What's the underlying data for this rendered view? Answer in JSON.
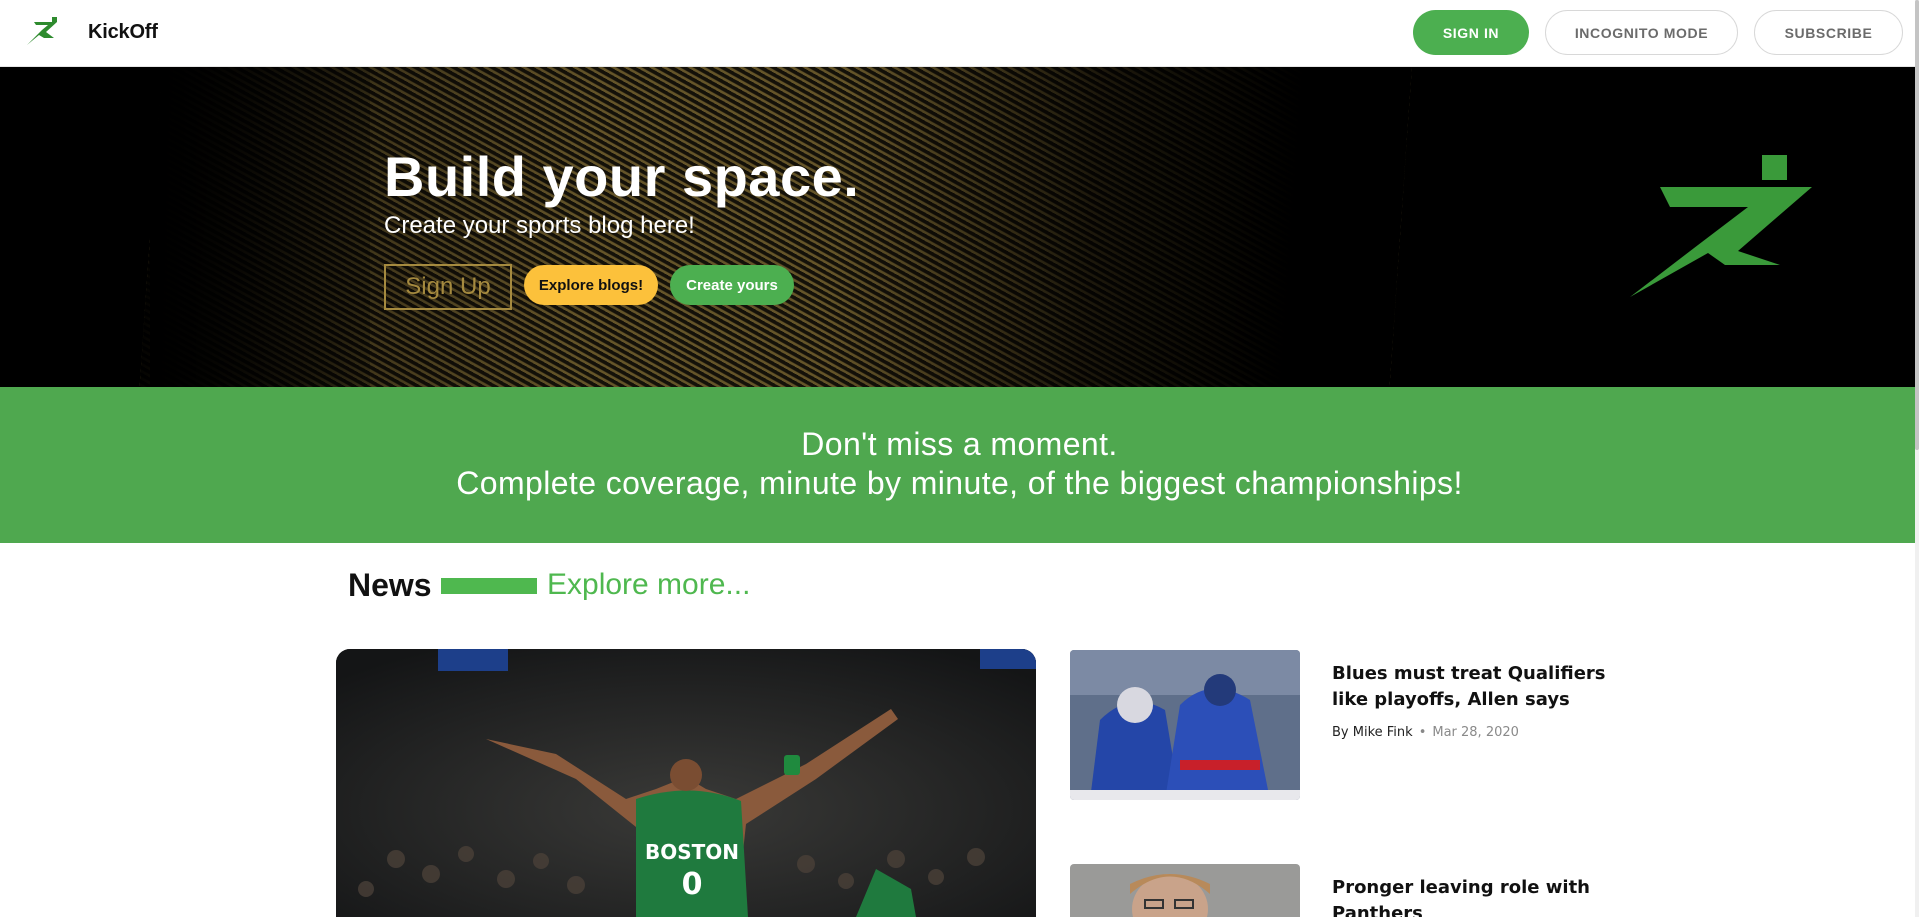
{
  "header": {
    "brand": "KickOff",
    "sign_in": "SIGN IN",
    "incognito": "INCOGNITO MODE",
    "subscribe": "SUBSCRIBE",
    "logo_icon": "runner-logo-icon"
  },
  "hero": {
    "title": "Build your space.",
    "subtitle": "Create your sports blog here!",
    "sign_up": "Sign Up",
    "explore": "Explore blogs!",
    "create": "Create yours",
    "logo_icon": "runner-logo-icon"
  },
  "banner": {
    "line1": "Don't miss a moment.",
    "line2": "Complete coverage, minute by minute, of the biggest championships!"
  },
  "news": {
    "title": "News",
    "more": "Explore more...",
    "articles": [
      {
        "title": "Blues must treat Qualifiers like playoffs, Allen says",
        "author": "By Mike Fink",
        "date": "Mar 28, 2020"
      },
      {
        "title": "Pronger leaving role with Panthers"
      }
    ],
    "feature_jersey": "BOSTON",
    "feature_number": "0"
  },
  "colors": {
    "accent_green": "#4caf50",
    "banner_green": "#4fa84f",
    "yellow": "#fcc13b",
    "gold": "#a58a3f"
  }
}
